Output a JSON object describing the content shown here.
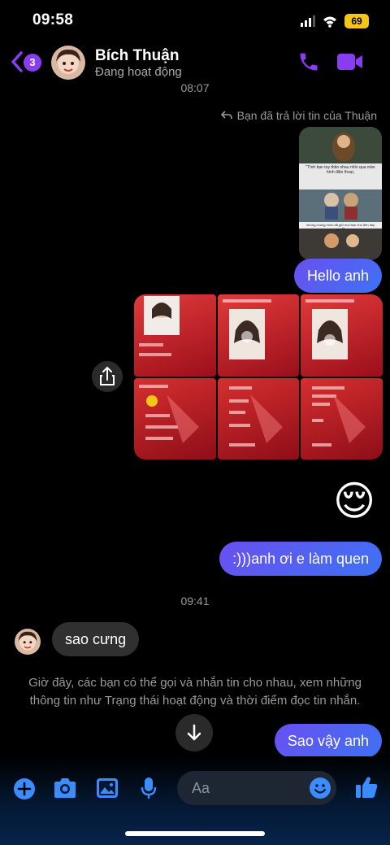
{
  "status_bar": {
    "time": "09:58",
    "battery": "69"
  },
  "header": {
    "unread_count": "3",
    "contact_name": "Bích Thuận",
    "contact_status": "Đang hoạt động"
  },
  "messages": {
    "time_1": "08:07",
    "reply_note": "Bạn đã trả lời tin của Thuận",
    "reply_image_caption_1": "\"Tình bạn tuy thân nhau nhìn qua màn hình điện thoại,",
    "reply_image_caption_2": "nhưng chúng mình đã giữ mọi bạn cho đến bây giờ 😊",
    "msg_hello": "Hello anh",
    "emoji_reaction": "😌",
    "msg_quen": ":)))anh ơi e làm quen",
    "time_2": "09:41",
    "msg_in": "sao cưng",
    "notice": "Giờ đây, các bạn có thể gọi và nhắn tin cho nhau, xem những thông tin như Trạng thái hoạt động và thời điểm đọc tin nhắn.",
    "msg_sao": "Sao vậy anh"
  },
  "composer": {
    "placeholder": "Aa"
  },
  "colors": {
    "accent": "#8a3cf0",
    "bubble_start": "#6a4ff0",
    "bubble_end": "#3d72f5",
    "incoming": "#303030",
    "composer_icon": "#3b8cff"
  }
}
